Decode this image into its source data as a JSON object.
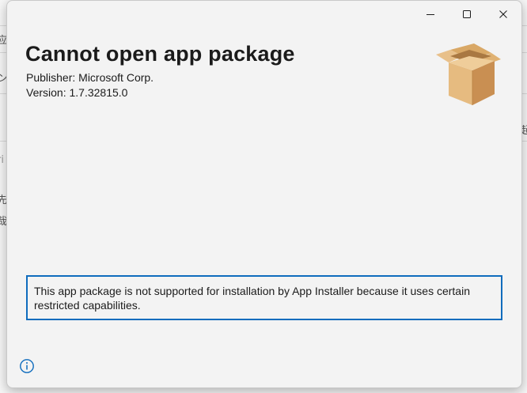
{
  "background_app": {
    "glyphs": [
      "应",
      "ン",
      "ri",
      "先",
      "哉",
      "起"
    ]
  },
  "window": {
    "caption_buttons": {
      "minimize_icon": "minimize-icon",
      "maximize_icon": "maximize-icon",
      "close_icon": "close-icon"
    },
    "title": "Cannot open app package",
    "publisher_label": "Publisher:",
    "publisher_value": "Microsoft Corp.",
    "version_label": "Version:",
    "version_value": "1.7.32815.0",
    "package_icon": "package-box-icon",
    "message": "This app package is not supported for installation by App Installer because it uses certain restricted capabilities.",
    "info_icon": "info-icon"
  },
  "colors": {
    "accent": "#0f6cbd",
    "window_bg": "#f3f3f3",
    "text": "#1b1b1b",
    "box_light": "#e3b77a",
    "box_dark": "#c8955a"
  }
}
